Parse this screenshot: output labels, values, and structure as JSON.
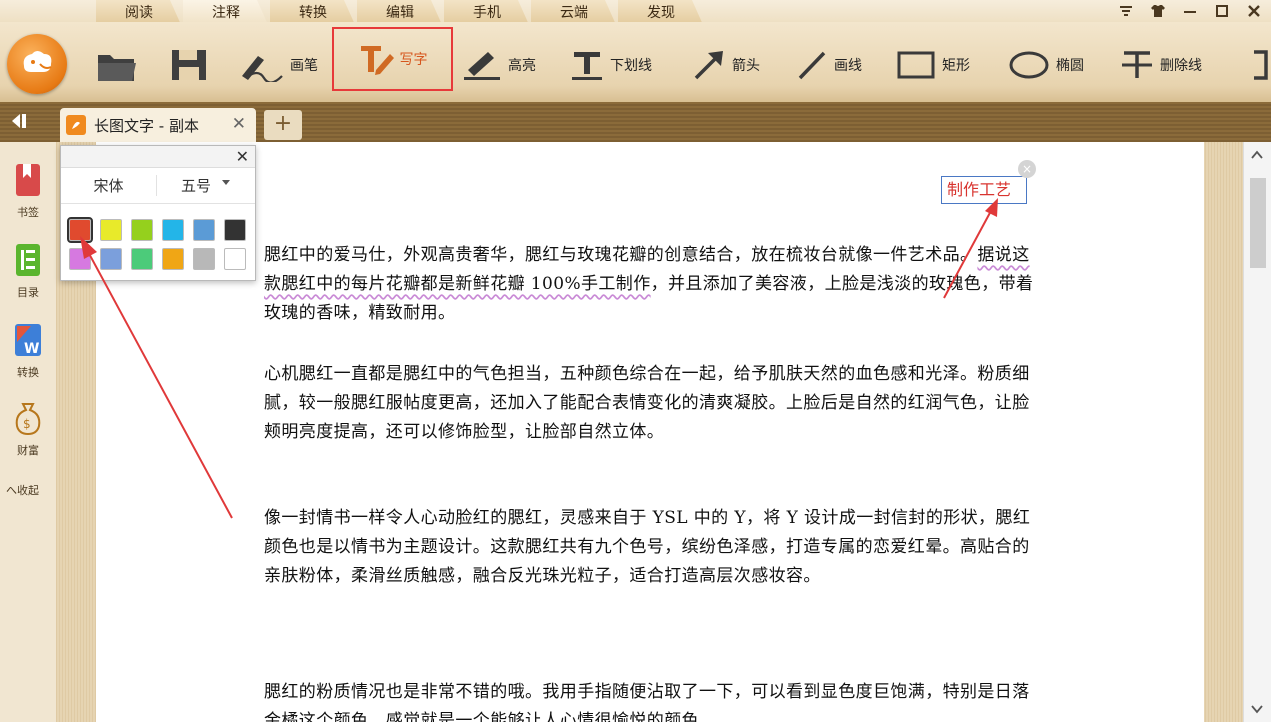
{
  "menu": {
    "tabs": [
      "阅读",
      "注释",
      "转换",
      "编辑",
      "手机",
      "云端",
      "发现"
    ],
    "active_tab": "注释"
  },
  "window_controls": [
    "▼",
    "👕",
    "—",
    "□",
    "✕"
  ],
  "toolbar": {
    "open_icon": "folder-icon",
    "save_icon": "save-icon",
    "tools": {
      "pen": "画笔",
      "write": "写字",
      "highlight": "高亮",
      "underline": "下划线",
      "arrow": "箭头",
      "line": "画线",
      "rect": "矩形",
      "ellipse": "椭圆",
      "strike": "删除线"
    },
    "highlight_color": "#e7393a"
  },
  "tabstrip": {
    "doc_title": "长图文字 - 副本",
    "close": "✕",
    "add": "+"
  },
  "sidebar": {
    "bookmark": "书签",
    "toc": "目录",
    "convert": "转换",
    "wealth": "财富",
    "collapse": "へ收起"
  },
  "popup": {
    "font": "宋体",
    "size": "五号",
    "close": "✕",
    "colors": [
      "#e04a2e",
      "#e8ea2a",
      "#95d01d",
      "#23b5e8",
      "#5b9bd6",
      "#333333",
      "#d679e0",
      "#7b9fdc",
      "#4ccb7a",
      "#f0a615",
      "#b8b8b8",
      "#ffffff"
    ],
    "selected_color": "#e04a2e"
  },
  "annotation": {
    "text": "制作工艺",
    "close": "×"
  },
  "document": {
    "p1_a": "腮红中的爱马仕，外观高贵奢华，腮红与玫瑰花瓣的创意结合，放在梳妆台就像一件艺术品。",
    "p1_b": "据说这款腮红中的每片花瓣都是新鲜花瓣 100%手工制作",
    "p1_c": "，并且添加了美容液，上脸是浅淡的玫瑰色，带着玫瑰的香味，精致耐用。",
    "p2": "心机腮红一直都是腮红中的气色担当，五种颜色综合在一起，给予肌肤天然的血色感和光泽。粉质细腻，较一般腮红服帖度更高，还加入了能配合表情变化的清爽凝胶。上脸后是自然的红润气色，让脸颊明亮度提高，还可以修饰脸型，让脸部自然立体。",
    "p3": "像一封情书一样令人心动脸红的腮红，灵感来自于 YSL 中的 Y，将 Y 设计成一封信封的形状，腮红颜色也是以情书为主题设计。这款腮红共有九个色号，缤纷色泽感，打造专属的恋爱红晕。高贴合的亲肤粉体，柔滑丝质触感，融合反光珠光粒子，适合打造高层次感妆容。",
    "p4": "腮红的粉质情况也是非常不错的哦。我用手指随便沾取了一下，可以看到显色度巨饱满，特别是日落金橘这个颜色，感觉就是一个能够让人心情很愉悦的颜色。"
  }
}
